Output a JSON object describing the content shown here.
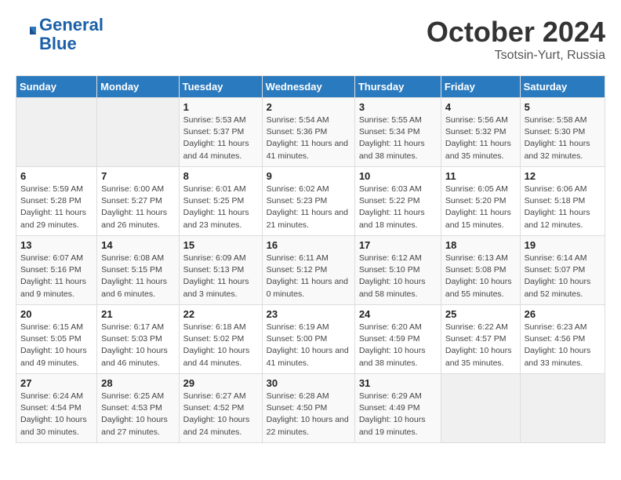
{
  "header": {
    "logo_line1": "General",
    "logo_line2": "Blue",
    "month": "October 2024",
    "location": "Tsotsin-Yurt, Russia"
  },
  "weekdays": [
    "Sunday",
    "Monday",
    "Tuesday",
    "Wednesday",
    "Thursday",
    "Friday",
    "Saturday"
  ],
  "weeks": [
    [
      {
        "day": "",
        "info": ""
      },
      {
        "day": "",
        "info": ""
      },
      {
        "day": "1",
        "info": "Sunrise: 5:53 AM\nSunset: 5:37 PM\nDaylight: 11 hours and 44 minutes."
      },
      {
        "day": "2",
        "info": "Sunrise: 5:54 AM\nSunset: 5:36 PM\nDaylight: 11 hours and 41 minutes."
      },
      {
        "day": "3",
        "info": "Sunrise: 5:55 AM\nSunset: 5:34 PM\nDaylight: 11 hours and 38 minutes."
      },
      {
        "day": "4",
        "info": "Sunrise: 5:56 AM\nSunset: 5:32 PM\nDaylight: 11 hours and 35 minutes."
      },
      {
        "day": "5",
        "info": "Sunrise: 5:58 AM\nSunset: 5:30 PM\nDaylight: 11 hours and 32 minutes."
      }
    ],
    [
      {
        "day": "6",
        "info": "Sunrise: 5:59 AM\nSunset: 5:28 PM\nDaylight: 11 hours and 29 minutes."
      },
      {
        "day": "7",
        "info": "Sunrise: 6:00 AM\nSunset: 5:27 PM\nDaylight: 11 hours and 26 minutes."
      },
      {
        "day": "8",
        "info": "Sunrise: 6:01 AM\nSunset: 5:25 PM\nDaylight: 11 hours and 23 minutes."
      },
      {
        "day": "9",
        "info": "Sunrise: 6:02 AM\nSunset: 5:23 PM\nDaylight: 11 hours and 21 minutes."
      },
      {
        "day": "10",
        "info": "Sunrise: 6:03 AM\nSunset: 5:22 PM\nDaylight: 11 hours and 18 minutes."
      },
      {
        "day": "11",
        "info": "Sunrise: 6:05 AM\nSunset: 5:20 PM\nDaylight: 11 hours and 15 minutes."
      },
      {
        "day": "12",
        "info": "Sunrise: 6:06 AM\nSunset: 5:18 PM\nDaylight: 11 hours and 12 minutes."
      }
    ],
    [
      {
        "day": "13",
        "info": "Sunrise: 6:07 AM\nSunset: 5:16 PM\nDaylight: 11 hours and 9 minutes."
      },
      {
        "day": "14",
        "info": "Sunrise: 6:08 AM\nSunset: 5:15 PM\nDaylight: 11 hours and 6 minutes."
      },
      {
        "day": "15",
        "info": "Sunrise: 6:09 AM\nSunset: 5:13 PM\nDaylight: 11 hours and 3 minutes."
      },
      {
        "day": "16",
        "info": "Sunrise: 6:11 AM\nSunset: 5:12 PM\nDaylight: 11 hours and 0 minutes."
      },
      {
        "day": "17",
        "info": "Sunrise: 6:12 AM\nSunset: 5:10 PM\nDaylight: 10 hours and 58 minutes."
      },
      {
        "day": "18",
        "info": "Sunrise: 6:13 AM\nSunset: 5:08 PM\nDaylight: 10 hours and 55 minutes."
      },
      {
        "day": "19",
        "info": "Sunrise: 6:14 AM\nSunset: 5:07 PM\nDaylight: 10 hours and 52 minutes."
      }
    ],
    [
      {
        "day": "20",
        "info": "Sunrise: 6:15 AM\nSunset: 5:05 PM\nDaylight: 10 hours and 49 minutes."
      },
      {
        "day": "21",
        "info": "Sunrise: 6:17 AM\nSunset: 5:03 PM\nDaylight: 10 hours and 46 minutes."
      },
      {
        "day": "22",
        "info": "Sunrise: 6:18 AM\nSunset: 5:02 PM\nDaylight: 10 hours and 44 minutes."
      },
      {
        "day": "23",
        "info": "Sunrise: 6:19 AM\nSunset: 5:00 PM\nDaylight: 10 hours and 41 minutes."
      },
      {
        "day": "24",
        "info": "Sunrise: 6:20 AM\nSunset: 4:59 PM\nDaylight: 10 hours and 38 minutes."
      },
      {
        "day": "25",
        "info": "Sunrise: 6:22 AM\nSunset: 4:57 PM\nDaylight: 10 hours and 35 minutes."
      },
      {
        "day": "26",
        "info": "Sunrise: 6:23 AM\nSunset: 4:56 PM\nDaylight: 10 hours and 33 minutes."
      }
    ],
    [
      {
        "day": "27",
        "info": "Sunrise: 6:24 AM\nSunset: 4:54 PM\nDaylight: 10 hours and 30 minutes."
      },
      {
        "day": "28",
        "info": "Sunrise: 6:25 AM\nSunset: 4:53 PM\nDaylight: 10 hours and 27 minutes."
      },
      {
        "day": "29",
        "info": "Sunrise: 6:27 AM\nSunset: 4:52 PM\nDaylight: 10 hours and 24 minutes."
      },
      {
        "day": "30",
        "info": "Sunrise: 6:28 AM\nSunset: 4:50 PM\nDaylight: 10 hours and 22 minutes."
      },
      {
        "day": "31",
        "info": "Sunrise: 6:29 AM\nSunset: 4:49 PM\nDaylight: 10 hours and 19 minutes."
      },
      {
        "day": "",
        "info": ""
      },
      {
        "day": "",
        "info": ""
      }
    ]
  ]
}
